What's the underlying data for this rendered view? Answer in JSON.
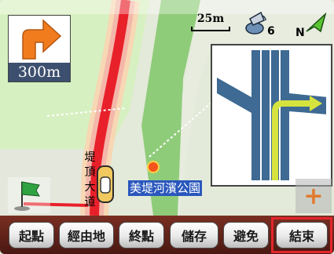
{
  "guidance": {
    "distance": "300m",
    "turn_icon": "turn-right-arrow"
  },
  "status": {
    "scale": "25m",
    "satellites": "6",
    "compass": "N"
  },
  "map": {
    "poi_label": "美堤河濱公園",
    "road_name": [
      "堤",
      "頂",
      "大",
      "道"
    ]
  },
  "toolbar": {
    "start": "起點",
    "via": "經由地",
    "end": "終點",
    "save": "儲存",
    "avoid": "避免",
    "finish": "結束"
  },
  "colors": {
    "accent_highlight": "#e3262b",
    "route": "#e8202a",
    "arrow": "#f07c1e"
  }
}
